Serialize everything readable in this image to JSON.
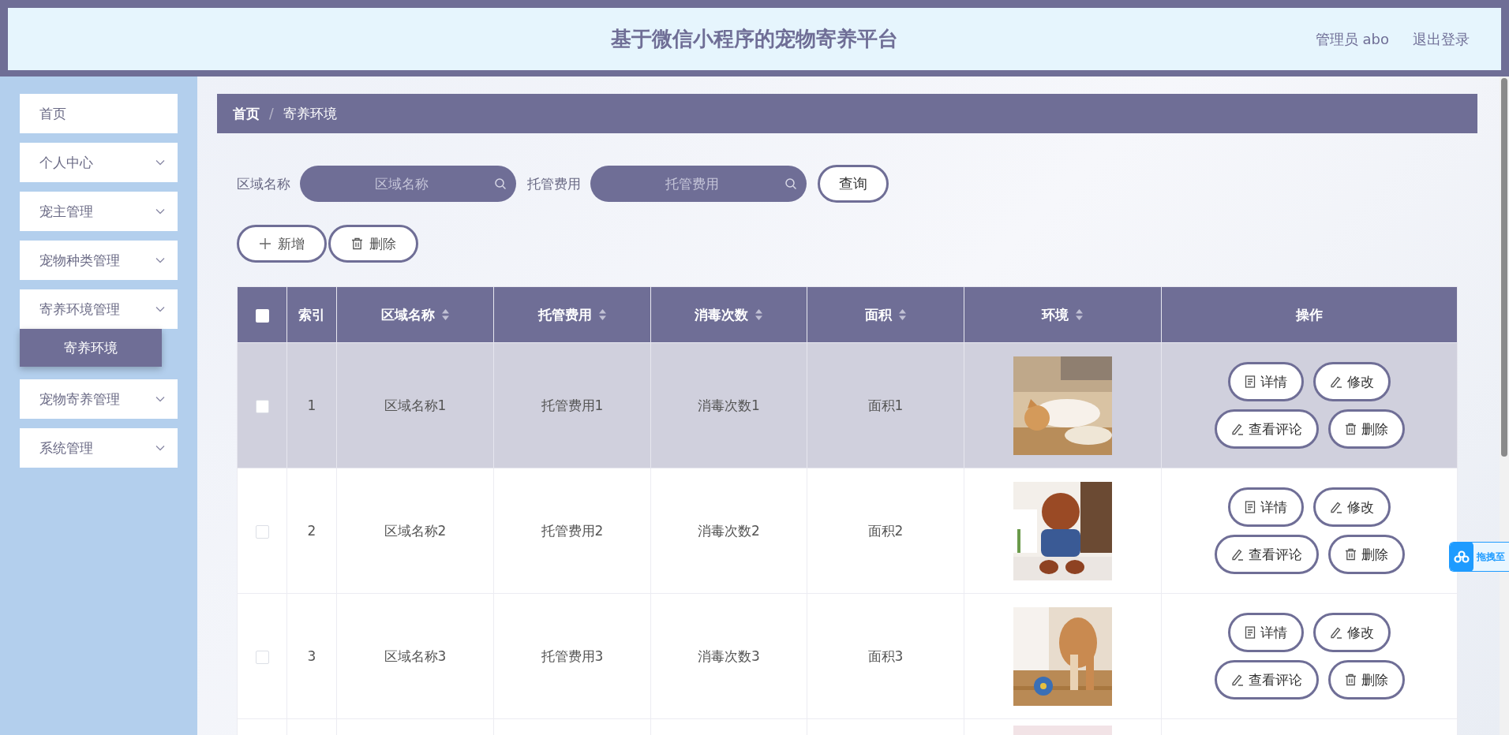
{
  "header": {
    "title": "基于微信小程序的宠物寄养平台",
    "user": "管理员 abo",
    "logout": "退出登录"
  },
  "sidebar": {
    "items": [
      {
        "label": "首页",
        "kind": "link"
      },
      {
        "label": "个人中心",
        "kind": "menu"
      },
      {
        "label": "宠主管理",
        "kind": "menu"
      },
      {
        "label": "宠物种类管理",
        "kind": "menu"
      },
      {
        "label": "寄养环境管理",
        "kind": "menu",
        "children": [
          {
            "label": "寄养环境",
            "selected": true
          }
        ]
      },
      {
        "label": "宠物寄养管理",
        "kind": "menu"
      },
      {
        "label": "系统管理",
        "kind": "menu"
      }
    ]
  },
  "breadcrumb": {
    "items": [
      "首页",
      "寄养环境"
    ],
    "separator": "/"
  },
  "search": {
    "fields": [
      {
        "label": "区域名称",
        "placeholder": "区域名称"
      },
      {
        "label": "托管费用",
        "placeholder": "托管费用"
      }
    ],
    "button": "查询"
  },
  "actions": [
    {
      "kind": "add",
      "label": "新增"
    },
    {
      "kind": "delete",
      "label": "删除"
    }
  ],
  "table": {
    "select_all": {
      "checked": false
    },
    "columns": [
      {
        "label": "索引",
        "sortable": false
      },
      {
        "label": "区域名称",
        "sortable": true
      },
      {
        "label": "托管费用",
        "sortable": true
      },
      {
        "label": "消毒次数",
        "sortable": true
      },
      {
        "label": "面积",
        "sortable": true
      },
      {
        "label": "环境",
        "sortable": true
      },
      {
        "label": "操作",
        "sortable": false
      }
    ],
    "rows": [
      {
        "kind": "full",
        "checked": false,
        "highlighted": true,
        "cells": [
          "1",
          "区域名称1",
          "托管费用1",
          "消毒次数1",
          "面积1"
        ],
        "image": {
          "kind": "picture"
        },
        "buttons": [
          {
            "kind": "detail",
            "label": "详情"
          },
          {
            "kind": "edit",
            "label": "修改"
          },
          {
            "kind": "comments",
            "label": "查看评论"
          },
          {
            "kind": "delete",
            "label": "删除"
          }
        ]
      },
      {
        "kind": "full",
        "checked": false,
        "highlighted": false,
        "cells": [
          "2",
          "区域名称2",
          "托管费用2",
          "消毒次数2",
          "面积2"
        ],
        "image": {
          "kind": "picture"
        },
        "buttons": [
          {
            "kind": "detail",
            "label": "详情"
          },
          {
            "kind": "edit",
            "label": "修改"
          },
          {
            "kind": "comments",
            "label": "查看评论"
          },
          {
            "kind": "delete",
            "label": "删除"
          }
        ]
      },
      {
        "kind": "full",
        "checked": false,
        "highlighted": false,
        "cells": [
          "3",
          "区域名称3",
          "托管费用3",
          "消毒次数3",
          "面积3"
        ],
        "image": {
          "kind": "picture"
        },
        "buttons": [
          {
            "kind": "detail",
            "label": "详情"
          },
          {
            "kind": "edit",
            "label": "修改"
          },
          {
            "kind": "comments",
            "label": "查看评论"
          },
          {
            "kind": "delete",
            "label": "删除"
          }
        ]
      },
      {
        "kind": "cut_off",
        "image": {
          "kind": "picture"
        }
      }
    ]
  },
  "side_widget": {
    "label": "拖拽至"
  }
}
